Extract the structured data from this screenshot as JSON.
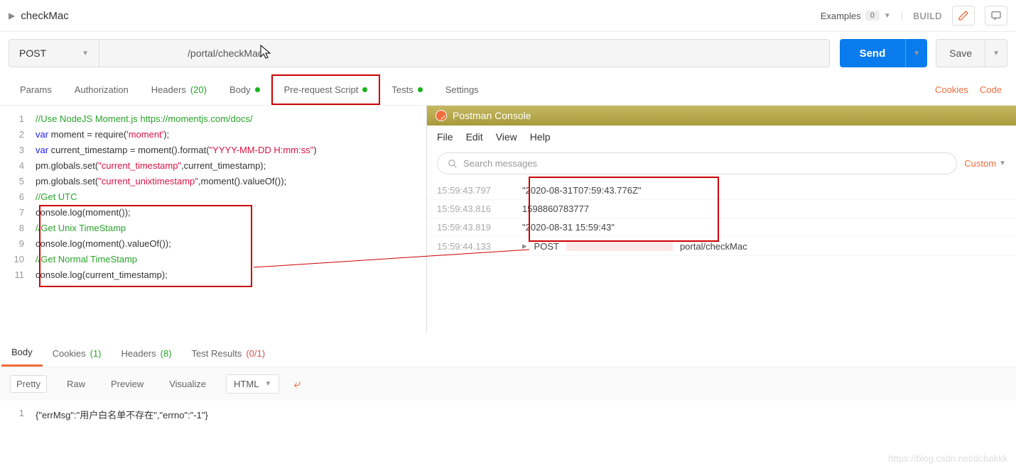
{
  "header": {
    "title": "checkMac",
    "examples_label": "Examples",
    "examples_count": "0",
    "build_label": "BUILD"
  },
  "request": {
    "method": "POST",
    "url_visible": "/portal/checkMac",
    "send_label": "Send",
    "save_label": "Save"
  },
  "tabs": {
    "params": "Params",
    "authorization": "Authorization",
    "headers": "Headers",
    "headers_count": "(20)",
    "body": "Body",
    "prerequest": "Pre-request Script",
    "tests": "Tests",
    "settings": "Settings",
    "cookies_link": "Cookies",
    "code_link": "Code"
  },
  "code": {
    "lines": [
      {
        "n": "1",
        "seg": [
          {
            "t": "//Use NodeJS Moment.js https://momentjs.com/docs/",
            "c": "c-comment"
          }
        ]
      },
      {
        "n": "2",
        "seg": [
          {
            "t": "var ",
            "c": "c-kw"
          },
          {
            "t": "moment = require(",
            "c": "c-fn"
          },
          {
            "t": "'moment'",
            "c": "c-str"
          },
          {
            "t": ");",
            "c": "c-fn"
          }
        ]
      },
      {
        "n": "3",
        "seg": [
          {
            "t": "var ",
            "c": "c-kw"
          },
          {
            "t": "current_timestamp = moment().format(",
            "c": "c-fn"
          },
          {
            "t": "\"YYYY-MM-DD H:mm:ss\"",
            "c": "c-str"
          },
          {
            "t": ")",
            "c": "c-fn"
          }
        ]
      },
      {
        "n": "4",
        "seg": [
          {
            "t": "pm.globals.set(",
            "c": "c-fn"
          },
          {
            "t": "\"current_timestamp\"",
            "c": "c-str"
          },
          {
            "t": ",current_timestamp);",
            "c": "c-fn"
          }
        ]
      },
      {
        "n": "5",
        "seg": [
          {
            "t": "pm.globals.set(",
            "c": "c-fn"
          },
          {
            "t": "\"current_unixtimestamp\"",
            "c": "c-str"
          },
          {
            "t": ",moment().valueOf());",
            "c": "c-fn"
          }
        ]
      },
      {
        "n": "6",
        "seg": [
          {
            "t": "//Get UTC",
            "c": "c-comment"
          }
        ]
      },
      {
        "n": "7",
        "seg": [
          {
            "t": "console.log(moment());",
            "c": "c-fn"
          }
        ]
      },
      {
        "n": "8",
        "seg": [
          {
            "t": "//Get Unix TimeStamp",
            "c": "c-comment"
          }
        ]
      },
      {
        "n": "9",
        "seg": [
          {
            "t": "console.log(moment().valueOf());",
            "c": "c-fn"
          }
        ]
      },
      {
        "n": "10",
        "seg": [
          {
            "t": "//Get Normal TimeStamp",
            "c": "c-comment"
          }
        ]
      },
      {
        "n": "11",
        "seg": [
          {
            "t": "console.log(current_timestamp);",
            "c": "c-fn"
          }
        ]
      }
    ]
  },
  "console": {
    "title": "Postman Console",
    "menu": {
      "file": "File",
      "edit": "Edit",
      "view": "View",
      "help": "Help"
    },
    "search_placeholder": "Search messages",
    "custom_label": "Custom",
    "logs": [
      {
        "time": "15:59:43.797",
        "val": "\"2020-08-31T07:59:43.776Z\""
      },
      {
        "time": "15:59:43.816",
        "val": "1598860783777"
      },
      {
        "time": "15:59:43.819",
        "val": "\"2020-08-31 15:59:43\""
      },
      {
        "time": "15:59:44.133",
        "val": "POST",
        "extra": "portal/checkMac",
        "arrow": true
      }
    ]
  },
  "response": {
    "tabs": {
      "body": "Body",
      "cookies": "Cookies",
      "cookies_count": "(1)",
      "headers": "Headers",
      "headers_count": "(8)",
      "test": "Test Results",
      "test_count": "(0/1)"
    },
    "views": {
      "pretty": "Pretty",
      "raw": "Raw",
      "preview": "Preview",
      "visualize": "Visualize"
    },
    "format": "HTML",
    "body_lines": [
      {
        "n": "1",
        "text": "{\"errMsg\":\"用户白名单不存在\",\"errno\":\"-1\"}"
      }
    ]
  },
  "watermark": "https://blog.csdn.net/dcbakkk"
}
